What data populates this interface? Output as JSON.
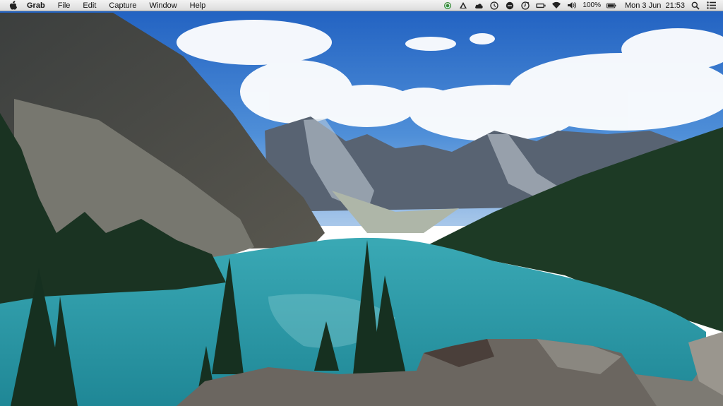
{
  "menubar": {
    "apple_icon": "apple-logo-icon",
    "app_name": "Grab",
    "menus": [
      "File",
      "Edit",
      "Capture",
      "Window",
      "Help"
    ],
    "status": {
      "icons": [
        "sync-icon",
        "upload-icon",
        "cloud-icon",
        "timemachine-icon",
        "chat-icon",
        "clock-app-icon",
        "battery-indicator-icon",
        "wifi-icon",
        "volume-icon"
      ],
      "battery_percent": "100%",
      "date": "Mon 3 Jun",
      "time": "21:53"
    }
  },
  "wallpaper": {
    "description_colors": {
      "sky": "#3f7fd0",
      "lake": "#2fa4b4",
      "forest": "#1c3a22"
    }
  }
}
